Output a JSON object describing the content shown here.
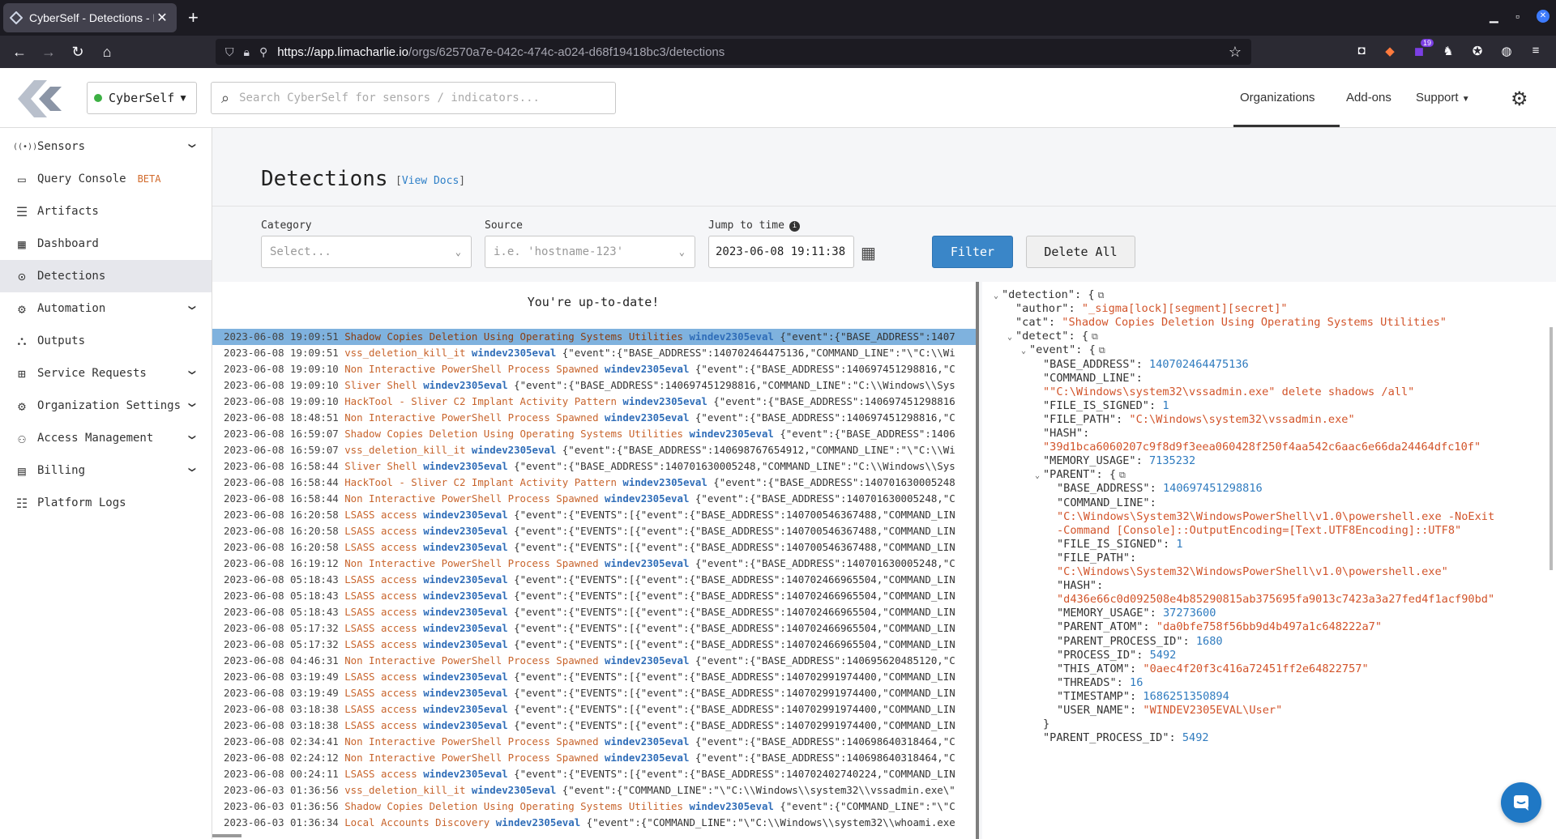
{
  "browser": {
    "tab_title": "CyberSelf - Detections - Lin",
    "url_host": "https://app.limacharlie.io",
    "url_path": "/orgs/62570a7e-042c-474c-a024-d68f19418bc3/detections",
    "extension_badge": "19"
  },
  "header": {
    "org_name": "CyberSelf",
    "search_placeholder": "Search CyberSelf for sensors / indicators...",
    "nav": [
      "Organizations",
      "Add-ons",
      "Support"
    ]
  },
  "sidebar": {
    "items": [
      {
        "label": "Sensors",
        "icon": "sensors-icon",
        "expandable": true
      },
      {
        "label": "Query Console",
        "icon": "terminal-icon",
        "badge": "BETA"
      },
      {
        "label": "Artifacts",
        "icon": "artifacts-icon"
      },
      {
        "label": "Dashboard",
        "icon": "dashboard-icon"
      },
      {
        "label": "Detections",
        "icon": "detections-icon",
        "active": true
      },
      {
        "label": "Automation",
        "icon": "automation-icon",
        "expandable": true
      },
      {
        "label": "Outputs",
        "icon": "outputs-icon"
      },
      {
        "label": "Service Requests",
        "icon": "plus-box-icon",
        "expandable": true
      },
      {
        "label": "Organization Settings",
        "icon": "gear-icon",
        "expandable": true
      },
      {
        "label": "Access Management",
        "icon": "users-icon",
        "expandable": true
      },
      {
        "label": "Billing",
        "icon": "card-icon",
        "expandable": true
      },
      {
        "label": "Platform Logs",
        "icon": "list-icon"
      }
    ]
  },
  "page": {
    "title": "Detections",
    "view_docs": "View Docs",
    "filters": {
      "category_label": "Category",
      "category_placeholder": "Select...",
      "source_label": "Source",
      "source_placeholder": "i.e. 'hostname-123'",
      "time_label": "Jump to time",
      "time_value": "2023-06-08 19:11:38",
      "filter_button": "Filter",
      "delete_button": "Delete All"
    },
    "status": "You're up-to-date!"
  },
  "detections": [
    {
      "time": "2023-06-08 19:09:51",
      "cat": "Shadow Copies Deletion Using Operating Systems Utilities",
      "host": "windev2305eval",
      "data": "{\"event\":{\"BASE_ADDRESS\":1407",
      "selected": true
    },
    {
      "time": "2023-06-08 19:09:51",
      "cat": "vss_deletion_kill_it",
      "host": "windev2305eval",
      "data": "{\"event\":{\"BASE_ADDRESS\":140702464475136,\"COMMAND_LINE\":\"\\\"C:\\\\Wi"
    },
    {
      "time": "2023-06-08 19:09:10",
      "cat": "Non Interactive PowerShell Process Spawned",
      "host": "windev2305eval",
      "data": "{\"event\":{\"BASE_ADDRESS\":140697451298816,\"C"
    },
    {
      "time": "2023-06-08 19:09:10",
      "cat": "Sliver Shell",
      "host": "windev2305eval",
      "data": "{\"event\":{\"BASE_ADDRESS\":140697451298816,\"COMMAND_LINE\":\"C:\\\\Windows\\\\Sys"
    },
    {
      "time": "2023-06-08 19:09:10",
      "cat": "HackTool - Sliver C2 Implant Activity Pattern",
      "host": "windev2305eval",
      "data": "{\"event\":{\"BASE_ADDRESS\":140697451298816"
    },
    {
      "time": "2023-06-08 18:48:51",
      "cat": "Non Interactive PowerShell Process Spawned",
      "host": "windev2305eval",
      "data": "{\"event\":{\"BASE_ADDRESS\":140697451298816,\"C"
    },
    {
      "time": "2023-06-08 16:59:07",
      "cat": "Shadow Copies Deletion Using Operating Systems Utilities",
      "host": "windev2305eval",
      "data": "{\"event\":{\"BASE_ADDRESS\":1406"
    },
    {
      "time": "2023-06-08 16:59:07",
      "cat": "vss_deletion_kill_it",
      "host": "windev2305eval",
      "data": "{\"event\":{\"BASE_ADDRESS\":140698767654912,\"COMMAND_LINE\":\"\\\"C:\\\\Wi"
    },
    {
      "time": "2023-06-08 16:58:44",
      "cat": "Sliver Shell",
      "host": "windev2305eval",
      "data": "{\"event\":{\"BASE_ADDRESS\":140701630005248,\"COMMAND_LINE\":\"C:\\\\Windows\\\\Sys"
    },
    {
      "time": "2023-06-08 16:58:44",
      "cat": "HackTool - Sliver C2 Implant Activity Pattern",
      "host": "windev2305eval",
      "data": "{\"event\":{\"BASE_ADDRESS\":140701630005248"
    },
    {
      "time": "2023-06-08 16:58:44",
      "cat": "Non Interactive PowerShell Process Spawned",
      "host": "windev2305eval",
      "data": "{\"event\":{\"BASE_ADDRESS\":140701630005248,\"C"
    },
    {
      "time": "2023-06-08 16:20:58",
      "cat": "LSASS access",
      "host": "windev2305eval",
      "data": "{\"event\":{\"EVENTS\":[{\"event\":{\"BASE_ADDRESS\":140700546367488,\"COMMAND_LIN"
    },
    {
      "time": "2023-06-08 16:20:58",
      "cat": "LSASS access",
      "host": "windev2305eval",
      "data": "{\"event\":{\"EVENTS\":[{\"event\":{\"BASE_ADDRESS\":140700546367488,\"COMMAND_LIN"
    },
    {
      "time": "2023-06-08 16:20:58",
      "cat": "LSASS access",
      "host": "windev2305eval",
      "data": "{\"event\":{\"EVENTS\":[{\"event\":{\"BASE_ADDRESS\":140700546367488,\"COMMAND_LIN"
    },
    {
      "time": "2023-06-08 16:19:12",
      "cat": "Non Interactive PowerShell Process Spawned",
      "host": "windev2305eval",
      "data": "{\"event\":{\"BASE_ADDRESS\":140701630005248,\"C"
    },
    {
      "time": "2023-06-08 05:18:43",
      "cat": "LSASS access",
      "host": "windev2305eval",
      "data": "{\"event\":{\"EVENTS\":[{\"event\":{\"BASE_ADDRESS\":140702466965504,\"COMMAND_LIN"
    },
    {
      "time": "2023-06-08 05:18:43",
      "cat": "LSASS access",
      "host": "windev2305eval",
      "data": "{\"event\":{\"EVENTS\":[{\"event\":{\"BASE_ADDRESS\":140702466965504,\"COMMAND_LIN"
    },
    {
      "time": "2023-06-08 05:18:43",
      "cat": "LSASS access",
      "host": "windev2305eval",
      "data": "{\"event\":{\"EVENTS\":[{\"event\":{\"BASE_ADDRESS\":140702466965504,\"COMMAND_LIN"
    },
    {
      "time": "2023-06-08 05:17:32",
      "cat": "LSASS access",
      "host": "windev2305eval",
      "data": "{\"event\":{\"EVENTS\":[{\"event\":{\"BASE_ADDRESS\":140702466965504,\"COMMAND_LIN"
    },
    {
      "time": "2023-06-08 05:17:32",
      "cat": "LSASS access",
      "host": "windev2305eval",
      "data": "{\"event\":{\"EVENTS\":[{\"event\":{\"BASE_ADDRESS\":140702466965504,\"COMMAND_LIN"
    },
    {
      "time": "2023-06-08 04:46:31",
      "cat": "Non Interactive PowerShell Process Spawned",
      "host": "windev2305eval",
      "data": "{\"event\":{\"BASE_ADDRESS\":140695620485120,\"C"
    },
    {
      "time": "2023-06-08 03:19:49",
      "cat": "LSASS access",
      "host": "windev2305eval",
      "data": "{\"event\":{\"EVENTS\":[{\"event\":{\"BASE_ADDRESS\":140702991974400,\"COMMAND_LIN"
    },
    {
      "time": "2023-06-08 03:19:49",
      "cat": "LSASS access",
      "host": "windev2305eval",
      "data": "{\"event\":{\"EVENTS\":[{\"event\":{\"BASE_ADDRESS\":140702991974400,\"COMMAND_LIN"
    },
    {
      "time": "2023-06-08 03:18:38",
      "cat": "LSASS access",
      "host": "windev2305eval",
      "data": "{\"event\":{\"EVENTS\":[{\"event\":{\"BASE_ADDRESS\":140702991974400,\"COMMAND_LIN"
    },
    {
      "time": "2023-06-08 03:18:38",
      "cat": "LSASS access",
      "host": "windev2305eval",
      "data": "{\"event\":{\"EVENTS\":[{\"event\":{\"BASE_ADDRESS\":140702991974400,\"COMMAND_LIN"
    },
    {
      "time": "2023-06-08 02:34:41",
      "cat": "Non Interactive PowerShell Process Spawned",
      "host": "windev2305eval",
      "data": "{\"event\":{\"BASE_ADDRESS\":140698640318464,\"C"
    },
    {
      "time": "2023-06-08 02:24:12",
      "cat": "Non Interactive PowerShell Process Spawned",
      "host": "windev2305eval",
      "data": "{\"event\":{\"BASE_ADDRESS\":140698640318464,\"C"
    },
    {
      "time": "2023-06-08 00:24:11",
      "cat": "LSASS access",
      "host": "windev2305eval",
      "data": "{\"event\":{\"EVENTS\":[{\"event\":{\"BASE_ADDRESS\":140702402740224,\"COMMAND_LIN"
    },
    {
      "time": "2023-06-03 01:36:56",
      "cat": "vss_deletion_kill_it",
      "host": "windev2305eval",
      "data": "{\"event\":{\"COMMAND_LINE\":\"\\\"C:\\\\Windows\\\\system32\\\\vssadmin.exe\\\""
    },
    {
      "time": "2023-06-03 01:36:56",
      "cat": "Shadow Copies Deletion Using Operating Systems Utilities",
      "host": "windev2305eval",
      "data": "{\"event\":{\"COMMAND_LINE\":\"\\\"C"
    },
    {
      "time": "2023-06-03 01:36:34",
      "cat": "Local Accounts Discovery",
      "host": "windev2305eval",
      "data": "{\"event\":{\"COMMAND_LINE\":\"\\\"C:\\\\Windows\\\\system32\\\\whoami.exe"
    }
  ],
  "detail_lines": [
    {
      "indent": 0,
      "toggle": "˅",
      "key": "\"detection\"",
      "sep": ": {",
      "copy": true
    },
    {
      "indent": 1,
      "key": "\"author\"",
      "sep": ": ",
      "val": "\"_sigma[lock][segment][secret]\"",
      "vtype": "s"
    },
    {
      "indent": 1,
      "key": "\"cat\"",
      "sep": ": ",
      "val": "\"Shadow Copies Deletion Using Operating Systems Utilities\"",
      "vtype": "s"
    },
    {
      "indent": 1,
      "toggle": "˅",
      "key": "\"detect\"",
      "sep": ": {",
      "copy": true
    },
    {
      "indent": 2,
      "toggle": "˅",
      "key": "\"event\"",
      "sep": ": {",
      "copy": true
    },
    {
      "indent": 3,
      "key": "\"BASE_ADDRESS\"",
      "sep": ": ",
      "val": "140702464475136",
      "vtype": "n"
    },
    {
      "indent": 3,
      "key": "\"COMMAND_LINE\"",
      "sep": ":"
    },
    {
      "indent": 3,
      "val": "\"\"C:\\Windows\\system32\\vssadmin.exe\" delete shadows /all\"",
      "vtype": "s"
    },
    {
      "indent": 3,
      "key": "\"FILE_IS_SIGNED\"",
      "sep": ": ",
      "val": "1",
      "vtype": "n"
    },
    {
      "indent": 3,
      "key": "\"FILE_PATH\"",
      "sep": ": ",
      "val": "\"C:\\Windows\\system32\\vssadmin.exe\"",
      "vtype": "s"
    },
    {
      "indent": 3,
      "key": "\"HASH\"",
      "sep": ":"
    },
    {
      "indent": 3,
      "val": "\"39d1bca6060207c9f8d9f3eea060428f250f4aa542c6aac6e66da24464dfc10f\"",
      "vtype": "s"
    },
    {
      "indent": 3,
      "key": "\"MEMORY_USAGE\"",
      "sep": ": ",
      "val": "7135232",
      "vtype": "n"
    },
    {
      "indent": 3,
      "toggle": "˅",
      "key": "\"PARENT\"",
      "sep": ": {",
      "copy": true
    },
    {
      "indent": 4,
      "key": "\"BASE_ADDRESS\"",
      "sep": ": ",
      "val": "140697451298816",
      "vtype": "n"
    },
    {
      "indent": 4,
      "key": "\"COMMAND_LINE\"",
      "sep": ":"
    },
    {
      "indent": 4,
      "val": "\"C:\\Windows\\System32\\WindowsPowerShell\\v1.0\\powershell.exe -NoExit",
      "vtype": "s"
    },
    {
      "indent": 4,
      "val": "-Command [Console]::OutputEncoding=[Text.UTF8Encoding]::UTF8\"",
      "vtype": "s"
    },
    {
      "indent": 4,
      "key": "\"FILE_IS_SIGNED\"",
      "sep": ": ",
      "val": "1",
      "vtype": "n"
    },
    {
      "indent": 4,
      "key": "\"FILE_PATH\"",
      "sep": ":"
    },
    {
      "indent": 4,
      "val": "\"C:\\Windows\\System32\\WindowsPowerShell\\v1.0\\powershell.exe\"",
      "vtype": "s"
    },
    {
      "indent": 4,
      "key": "\"HASH\"",
      "sep": ":"
    },
    {
      "indent": 4,
      "val": "\"d436e66c0d092508e4b85290815ab375695fa9013c7423a3a27fed4f1acf90bd\"",
      "vtype": "s"
    },
    {
      "indent": 4,
      "key": "\"MEMORY_USAGE\"",
      "sep": ": ",
      "val": "37273600",
      "vtype": "n"
    },
    {
      "indent": 4,
      "key": "\"PARENT_ATOM\"",
      "sep": ": ",
      "val": "\"da0bfe758f56bb9d4b497a1c648222a7\"",
      "vtype": "s"
    },
    {
      "indent": 4,
      "key": "\"PARENT_PROCESS_ID\"",
      "sep": ": ",
      "val": "1680",
      "vtype": "n"
    },
    {
      "indent": 4,
      "key": "\"PROCESS_ID\"",
      "sep": ": ",
      "val": "5492",
      "vtype": "n"
    },
    {
      "indent": 4,
      "key": "\"THIS_ATOM\"",
      "sep": ": ",
      "val": "\"0aec4f20f3c416a72451ff2e64822757\"",
      "vtype": "s"
    },
    {
      "indent": 4,
      "key": "\"THREADS\"",
      "sep": ": ",
      "val": "16",
      "vtype": "n"
    },
    {
      "indent": 4,
      "key": "\"TIMESTAMP\"",
      "sep": ": ",
      "val": "1686251350894",
      "vtype": "n"
    },
    {
      "indent": 4,
      "key": "\"USER_NAME\"",
      "sep": ": ",
      "val": "\"WINDEV2305EVAL\\User\"",
      "vtype": "s"
    },
    {
      "indent": 3,
      "key": "}",
      "sep": ""
    },
    {
      "indent": 3,
      "key": "\"PARENT_PROCESS_ID\"",
      "sep": ": ",
      "val": "5492",
      "vtype": "n"
    }
  ],
  "colors": {
    "accent": "#3a86c8",
    "category": "#c8642c",
    "hostname": "#2f6db8",
    "json_string": "#d2542a",
    "json_number": "#2f7bbf",
    "selected_row": "#7fb2de"
  }
}
